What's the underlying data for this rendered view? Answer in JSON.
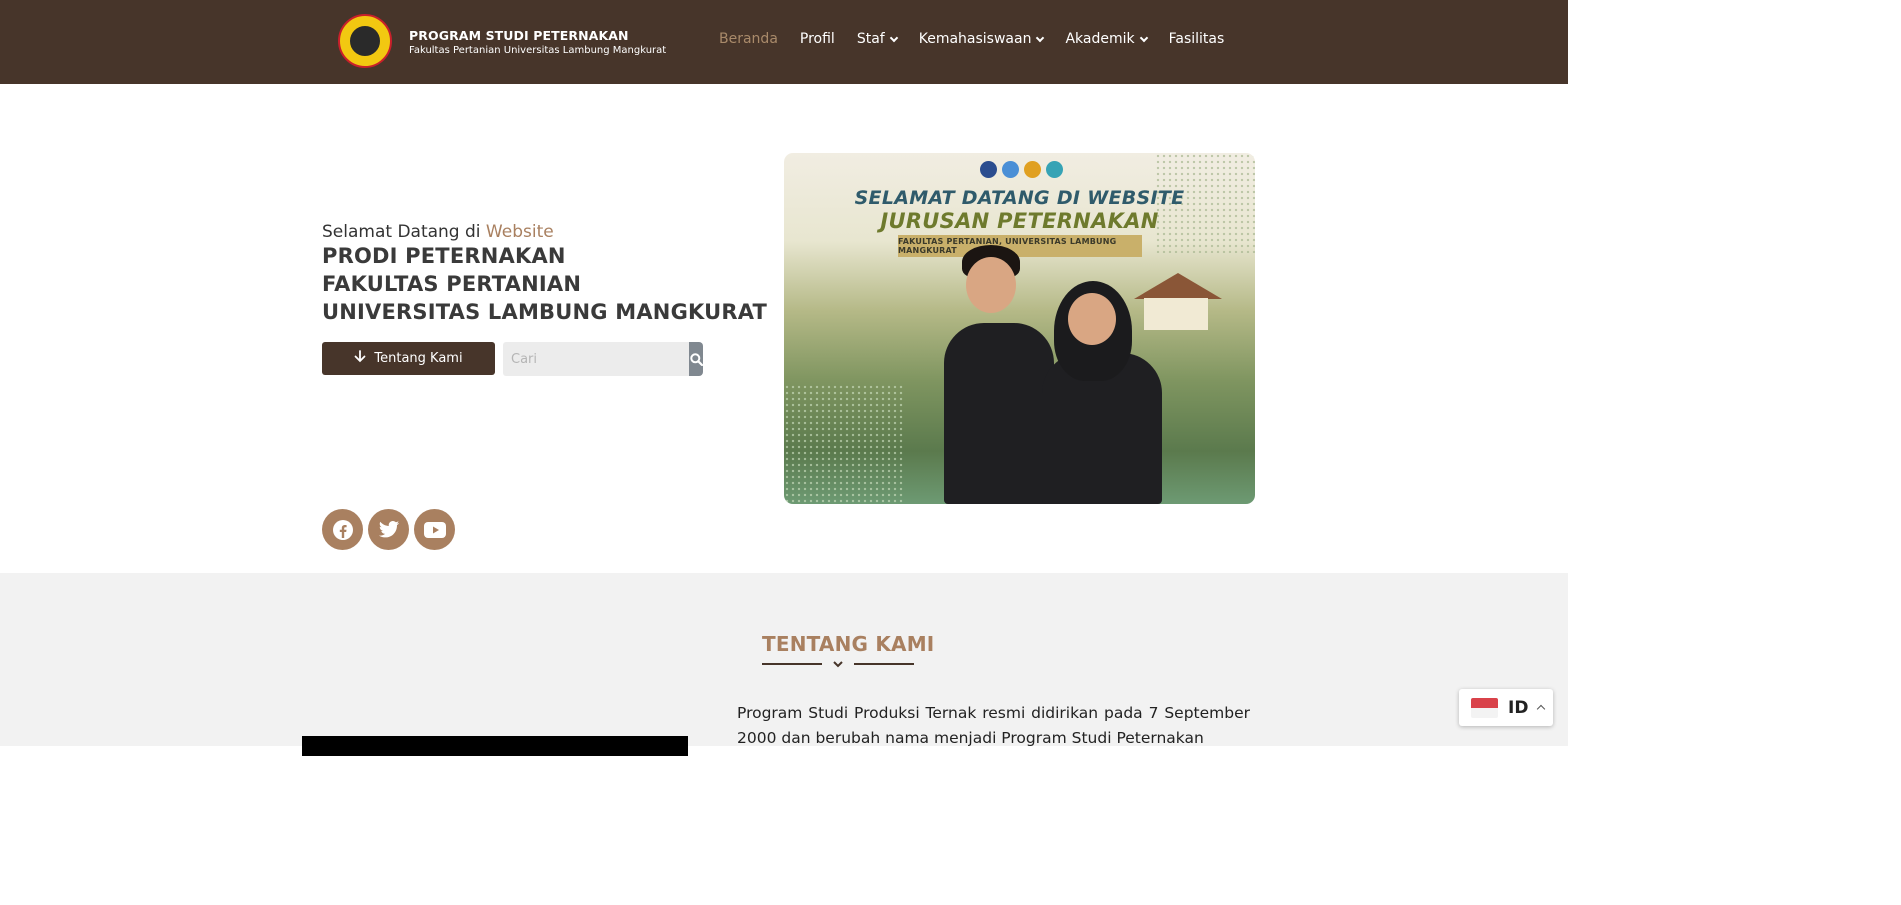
{
  "header": {
    "brand_title": "PROGRAM STUDI PETERNAKAN",
    "brand_subtitle": "Fakultas Pertanian Universitas Lambung Mangkurat",
    "nav": [
      {
        "label": "Beranda",
        "active": true
      },
      {
        "label": "Profil"
      },
      {
        "label": "Staf",
        "dropdown": true
      },
      {
        "label": "Kemahasiswaan",
        "dropdown": true
      },
      {
        "label": "Akademik",
        "dropdown": true
      },
      {
        "label": "Fasilitas"
      }
    ]
  },
  "hero": {
    "welcome_prefix": "Selamat Datang di",
    "welcome_accent": "Website",
    "title_line1": "PRODI PETERNAKAN",
    "title_line2": "FAKULTAS PERTANIAN",
    "title_line3": "UNIVERSITAS LAMBUNG MANGKURAT",
    "about_button": "Tentang Kami",
    "search_placeholder": "Cari",
    "image": {
      "heading1": "SELAMAT DATANG DI WEBSITE",
      "heading2": "JURUSAN PETERNAKAN",
      "band": "FAKULTAS PERTANIAN, UNIVERSITAS LAMBUNG MANGKURAT"
    }
  },
  "social": [
    "facebook-icon",
    "twitter-icon",
    "youtube-icon"
  ],
  "about": {
    "title": "TENTANG KAMI",
    "text": "Program Studi Produksi Ternak resmi didirikan pada 7 September 2000 dan berubah nama menjadi Program Studi Peternakan"
  },
  "language": {
    "code": "ID"
  },
  "colors": {
    "header_bg": "#47352a",
    "accent": "#a98060",
    "section_bg": "#f2f2f2"
  }
}
